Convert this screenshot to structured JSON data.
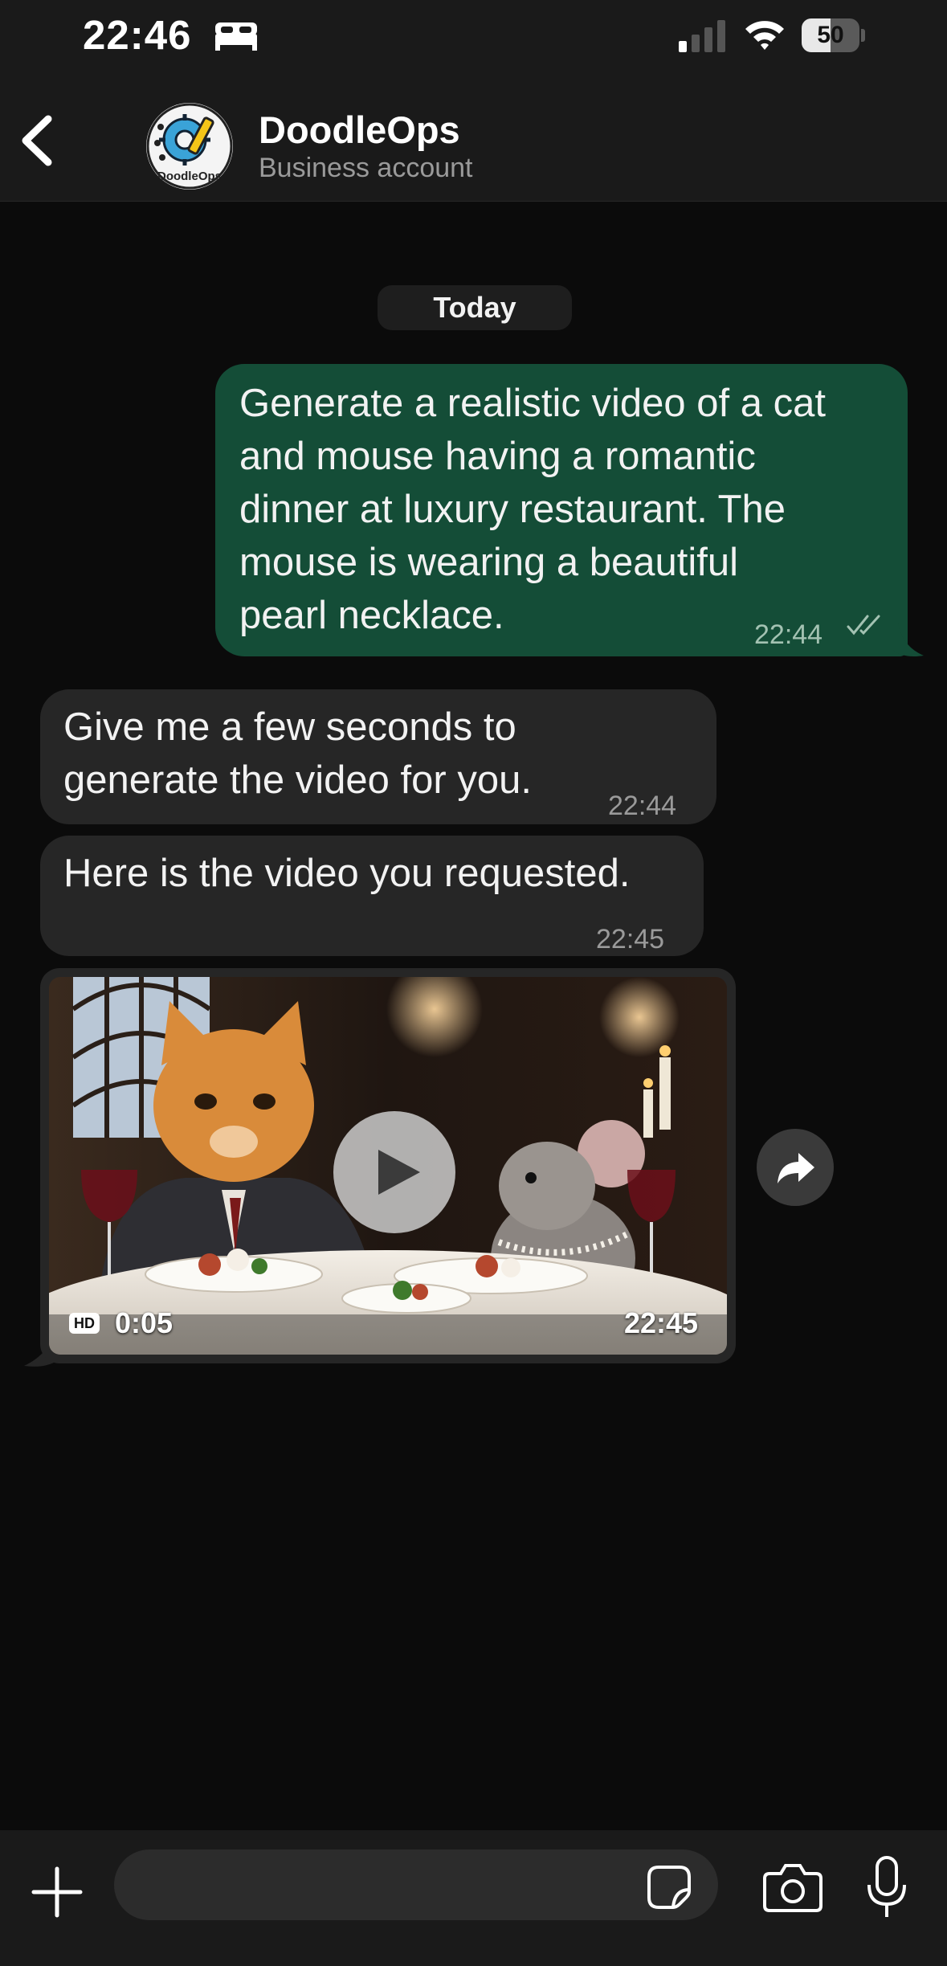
{
  "status_bar": {
    "time": "22:46",
    "battery": "50",
    "battery_level": 0.5,
    "icons": [
      "sleep-bed-icon",
      "cellular-signal-icon",
      "wifi-icon",
      "battery-icon"
    ]
  },
  "header": {
    "contact_name": "DoodleOps",
    "subtitle": "Business account",
    "avatar_text": "DoodleOps",
    "back_icon": "chevron-left-icon"
  },
  "chat": {
    "date_label": "Today",
    "messages": [
      {
        "direction": "outgoing",
        "text": "Generate a realistic video of a cat\nand mouse having a romantic\ndinner at luxury restaurant. The\nmouse is wearing a beautiful\npearl necklace.",
        "time": "22:44",
        "status_icon": "double-check-icon"
      },
      {
        "direction": "incoming",
        "text": "Give me a few seconds to\ngenerate the video for you.",
        "time": "22:44"
      },
      {
        "direction": "incoming",
        "text": "Here is the video you requested.",
        "time": "22:45"
      }
    ],
    "video": {
      "hd_label": "HD",
      "duration": "0:05",
      "time": "22:45",
      "play_icon": "play-icon",
      "forward_icon": "forward-arrow-icon"
    }
  },
  "input_bar": {
    "placeholder": "",
    "icons": [
      "plus-icon",
      "sticker-icon",
      "camera-icon",
      "microphone-icon"
    ]
  },
  "colors": {
    "background": "#0b0b0b",
    "bar_background": "#1a1a1a",
    "outgoing_bubble": "#144d37",
    "incoming_bubble": "#262626",
    "meta_text": "#9a9a9a"
  }
}
